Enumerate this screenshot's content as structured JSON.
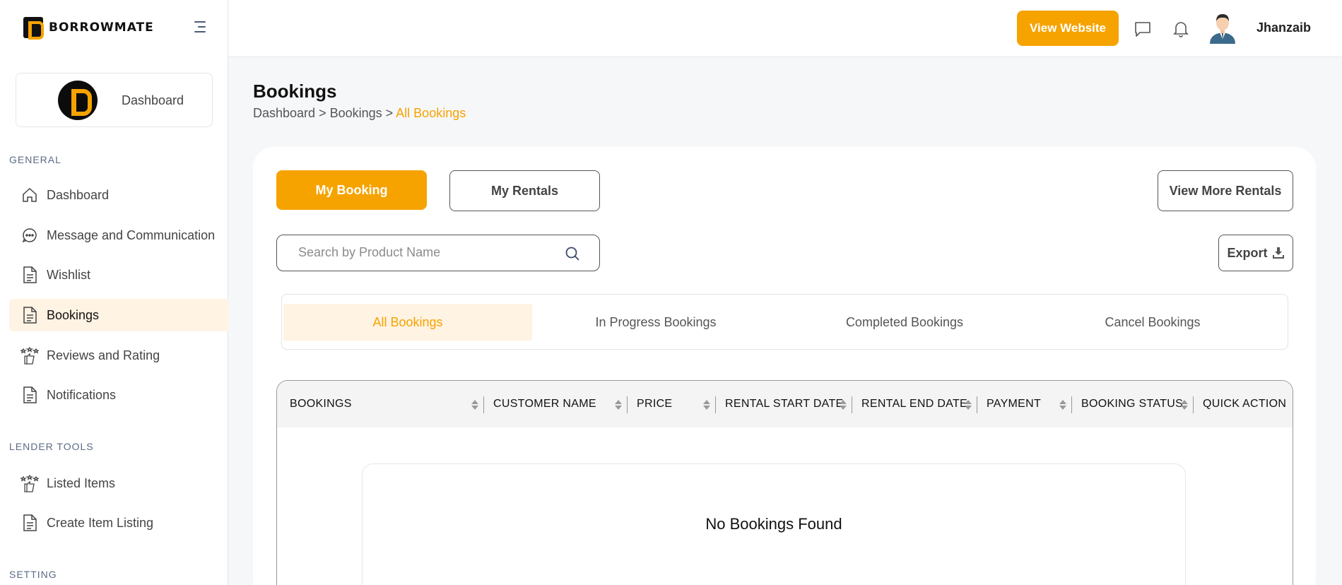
{
  "app": {
    "logo_text": "BORROWMATE"
  },
  "header": {
    "view_website_label": "View Website",
    "user_name": "Jhanzaib",
    "icons": [
      "chat-icon",
      "bell-icon"
    ]
  },
  "sidebar": {
    "profile_label": "Dashboard",
    "sections": {
      "general": "GENERAL",
      "lender_tools": "LENDER TOOLS",
      "setting": "SETTING"
    },
    "general_items": [
      {
        "label": "Dashboard",
        "icon": "home-icon"
      },
      {
        "label": "Message and Communication",
        "icon": "chat-bubble-icon"
      },
      {
        "label": "Wishlist",
        "icon": "document-icon"
      },
      {
        "label": "Bookings",
        "icon": "document-icon",
        "active": true
      },
      {
        "label": "Reviews and Rating",
        "icon": "thumbs-up-stars-icon"
      },
      {
        "label": "Notifications",
        "icon": "document-icon"
      }
    ],
    "lender_items": [
      {
        "label": "Listed Items",
        "icon": "thumbs-up-stars-icon"
      },
      {
        "label": "Create Item Listing",
        "icon": "document-icon"
      }
    ]
  },
  "page": {
    "title": "Bookings",
    "breadcrumb": {
      "part1": "Dashboard",
      "sep": " > ",
      "part2": "Bookings",
      "current": "All Bookings"
    }
  },
  "toggles": {
    "my_booking": "My Booking",
    "my_rentals": "My Rentals",
    "view_more_rentals": "View More Rentals"
  },
  "search": {
    "placeholder": "Search by Product Name",
    "value": ""
  },
  "export_label": "Export",
  "filter_tabs": [
    {
      "label": "All Bookings",
      "active": true
    },
    {
      "label": "In Progress Bookings"
    },
    {
      "label": "Completed Bookings"
    },
    {
      "label": "Cancel Bookings"
    }
  ],
  "table": {
    "columns": [
      "BOOKINGS",
      "CUSTOMER NAME",
      "PRICE",
      "RENTAL START DATE",
      "RENTAL END DATE",
      "PAYMENT",
      "BOOKING STATUS",
      "QUICK ACTION"
    ],
    "empty_message": "No Bookings Found"
  },
  "colors": {
    "accent": "#f6a300",
    "accent_light": "#fff3e3"
  }
}
